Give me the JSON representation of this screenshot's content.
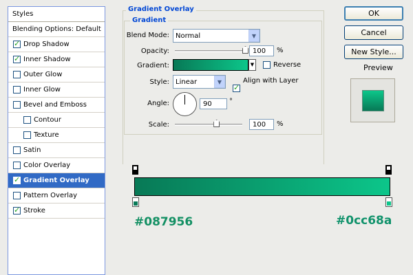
{
  "styles_panel": {
    "header": "Styles",
    "items": [
      {
        "label": "Blending Options: Default",
        "checkbox": false,
        "checked": false,
        "indent": false,
        "selected": false
      },
      {
        "label": "Drop Shadow",
        "checkbox": true,
        "checked": true,
        "indent": false,
        "selected": false
      },
      {
        "label": "Inner Shadow",
        "checkbox": true,
        "checked": true,
        "indent": false,
        "selected": false
      },
      {
        "label": "Outer Glow",
        "checkbox": true,
        "checked": false,
        "indent": false,
        "selected": false
      },
      {
        "label": "Inner Glow",
        "checkbox": true,
        "checked": false,
        "indent": false,
        "selected": false
      },
      {
        "label": "Bevel and Emboss",
        "checkbox": true,
        "checked": false,
        "indent": false,
        "selected": false
      },
      {
        "label": "Contour",
        "checkbox": true,
        "checked": false,
        "indent": true,
        "selected": false
      },
      {
        "label": "Texture",
        "checkbox": true,
        "checked": false,
        "indent": true,
        "selected": false
      },
      {
        "label": "Satin",
        "checkbox": true,
        "checked": false,
        "indent": false,
        "selected": false
      },
      {
        "label": "Color Overlay",
        "checkbox": true,
        "checked": false,
        "indent": false,
        "selected": false
      },
      {
        "label": "Gradient Overlay",
        "checkbox": true,
        "checked": true,
        "indent": false,
        "selected": true
      },
      {
        "label": "Pattern Overlay",
        "checkbox": true,
        "checked": false,
        "indent": false,
        "selected": false
      },
      {
        "label": "Stroke",
        "checkbox": true,
        "checked": true,
        "indent": false,
        "selected": false
      }
    ]
  },
  "gradient_overlay": {
    "title": "Gradient Overlay",
    "subtitle": "Gradient",
    "blend_mode_label": "Blend Mode:",
    "blend_mode_value": "Normal",
    "opacity_label": "Opacity:",
    "opacity_value": "100",
    "opacity_unit": "%",
    "opacity_fraction": 1.0,
    "gradient_label": "Gradient:",
    "reverse_label": "Reverse",
    "reverse_checked": false,
    "style_label": "Style:",
    "style_value": "Linear",
    "align_label": "Align with Layer",
    "align_checked": true,
    "angle_label": "Angle:",
    "angle_value": "90",
    "angle_unit": "°",
    "scale_label": "Scale:",
    "scale_value": "100",
    "scale_unit": "%",
    "scale_fraction": 0.4
  },
  "buttons": {
    "ok": "OK",
    "cancel": "Cancel",
    "new_style": "New Style...",
    "preview_label": "Preview",
    "preview_checked": true
  },
  "gradient_editor": {
    "start_color_label": "#087956",
    "end_color_label": "#0cc68a"
  },
  "colors": {
    "gradient_start": "#087956",
    "gradient_end": "#0cc68a",
    "label_start": "#149064",
    "label_end": "#10926b",
    "selection": "#316ac5",
    "group_title": "#0046d5"
  }
}
